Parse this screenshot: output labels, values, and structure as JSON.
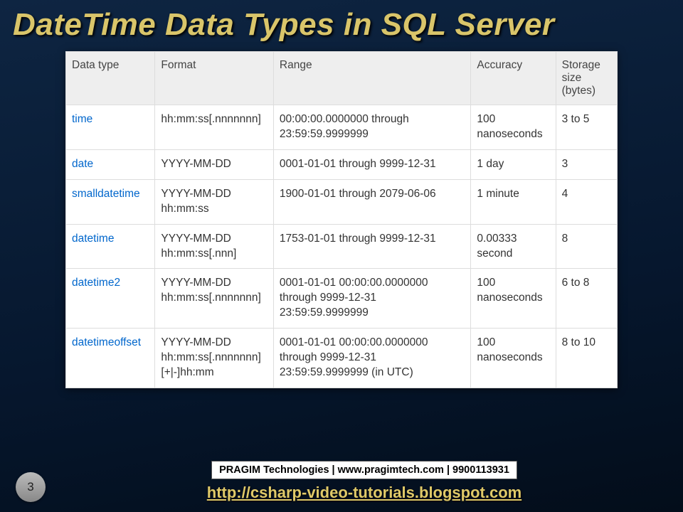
{
  "title": "DateTime Data Types in SQL Server",
  "table": {
    "headers": [
      "Data type",
      "Format",
      "Range",
      "Accuracy",
      "Storage size (bytes)"
    ],
    "rows": [
      {
        "type": "time",
        "format": "hh:mm:ss[.nnnnnnn]",
        "range": "00:00:00.0000000 through 23:59:59.9999999",
        "accuracy": "100 nanoseconds",
        "storage": "3 to 5"
      },
      {
        "type": "date",
        "format": "YYYY-MM-DD",
        "range": "0001-01-01 through 9999-12-31",
        "accuracy": "1 day",
        "storage": "3"
      },
      {
        "type": "smalldatetime",
        "format": "YYYY-MM-DD hh:mm:ss",
        "range": "1900-01-01 through 2079-06-06",
        "accuracy": "1 minute",
        "storage": "4"
      },
      {
        "type": "datetime",
        "format": "YYYY-MM-DD hh:mm:ss[.nnn]",
        "range": "1753-01-01 through 9999-12-31",
        "accuracy": "0.00333 second",
        "storage": "8"
      },
      {
        "type": "datetime2",
        "format": "YYYY-MM-DD hh:mm:ss[.nnnnnnn]",
        "range": "0001-01-01 00:00:00.0000000 through 9999-12-31 23:59:59.9999999",
        "accuracy": "100 nanoseconds",
        "storage": "6 to 8"
      },
      {
        "type": "datetimeoffset",
        "format": "YYYY-MM-DD hh:mm:ss[.nnnnnnn] [+|-]hh:mm",
        "range": "0001-01-01 00:00:00.0000000 through 9999-12-31 23:59:59.9999999 (in UTC)",
        "accuracy": "100 nanoseconds",
        "storage": "8 to 10"
      }
    ]
  },
  "footer": {
    "page_number": "3",
    "pragim": "PRAGIM Technologies | www.pragimtech.com | 9900113931",
    "link": "http://csharp-video-tutorials.blogspot.com"
  }
}
